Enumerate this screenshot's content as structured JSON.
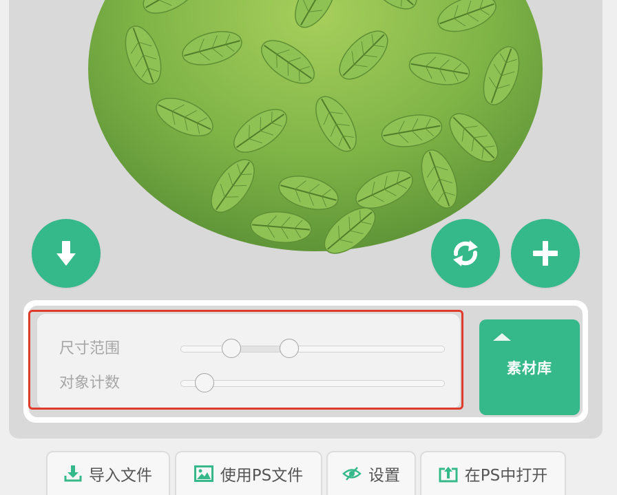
{
  "canvas": {
    "buttons": {
      "download": "download-icon",
      "refresh": "refresh-icon",
      "add": "plus-icon"
    },
    "accent_color": "#35b98a"
  },
  "panel": {
    "controls": [
      {
        "label": "尺寸范围",
        "type": "range",
        "min_fraction": 0.19,
        "max_fraction": 0.41
      },
      {
        "label": "对象计数",
        "type": "slider",
        "value_fraction": 0.09
      }
    ],
    "library_button": {
      "label": "素材库",
      "icon": "caret-up-icon"
    }
  },
  "toolbar": {
    "import_label": "导入文件",
    "use_ps_label": "使用PS文件",
    "settings_label": "设置",
    "open_in_ps_label": "在PS中打开"
  }
}
